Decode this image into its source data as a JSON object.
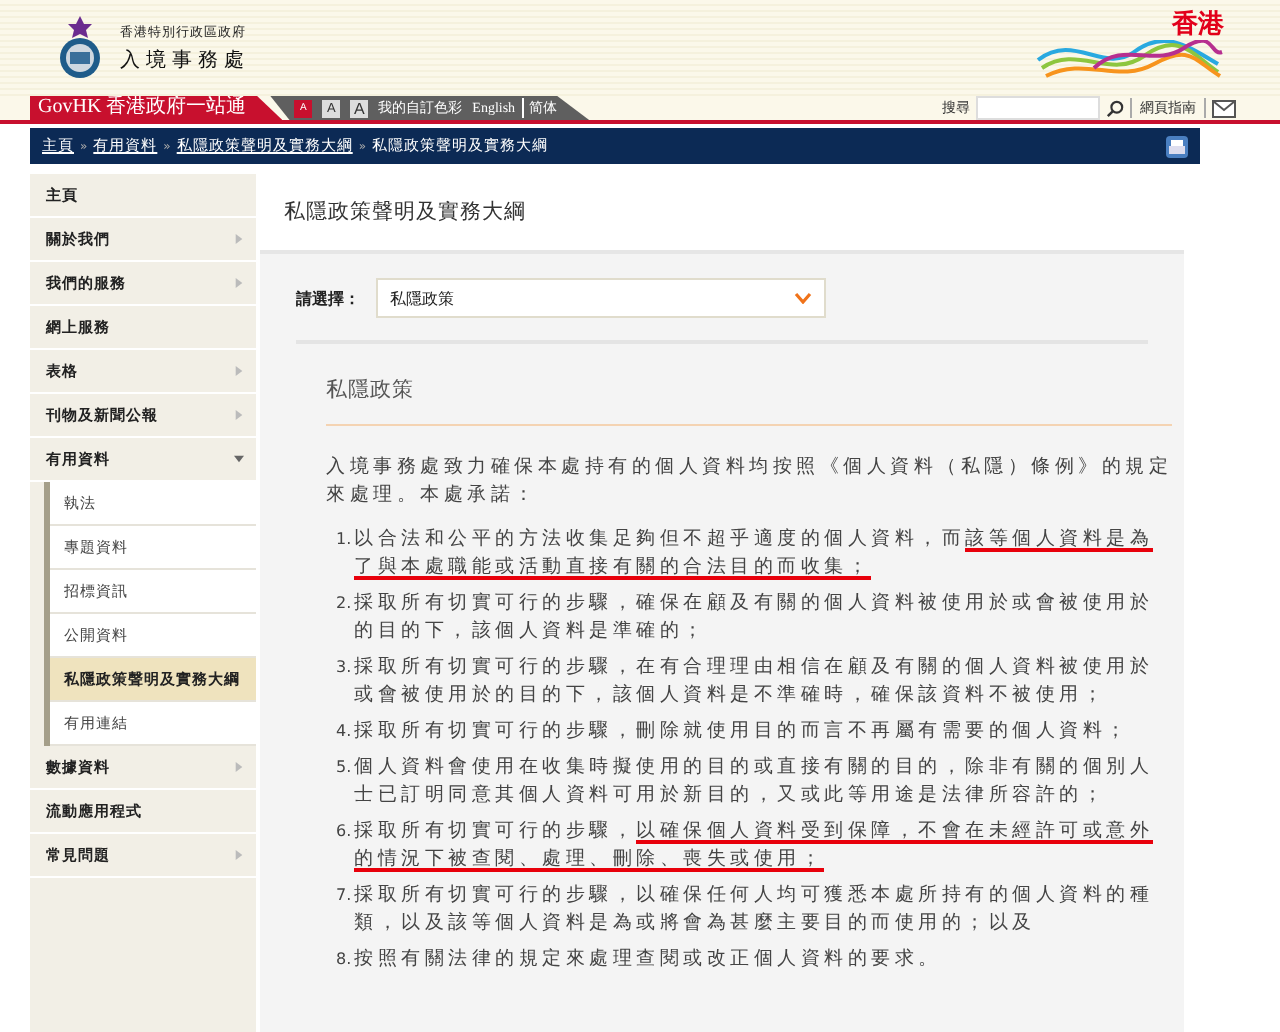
{
  "header": {
    "government": "香港特別行政區政府",
    "department": "入境事務處",
    "brand": "香港"
  },
  "topbar": {
    "govhk": "GovHK 香港政府一站通",
    "font_size_buttons": [
      "A",
      "A",
      "A"
    ],
    "custom_colour": "我的自訂色彩",
    "languages": [
      "English",
      "简体"
    ],
    "search_label": "搜尋",
    "site_guide": "網頁指南"
  },
  "breadcrumb_separator": "»",
  "breadcrumb": [
    {
      "label": "主頁",
      "link": true
    },
    {
      "label": "有用資料",
      "link": true
    },
    {
      "label": "私隱政策聲明及實務大綱",
      "link": true
    },
    {
      "label": "私隱政策聲明及實務大綱",
      "link": false
    }
  ],
  "sidebar": {
    "items": [
      {
        "label": "主頁",
        "has_submenu": false,
        "expanded": false,
        "selected": false
      },
      {
        "label": "關於我們",
        "has_submenu": true,
        "expanded": false,
        "selected": false
      },
      {
        "label": "我們的服務",
        "has_submenu": true,
        "expanded": false,
        "selected": false
      },
      {
        "label": "網上服務",
        "has_submenu": false,
        "expanded": false,
        "selected": false
      },
      {
        "label": "表格",
        "has_submenu": true,
        "expanded": false,
        "selected": false
      },
      {
        "label": "刊物及新聞公報",
        "has_submenu": true,
        "expanded": false,
        "selected": false
      },
      {
        "label": "有用資料",
        "has_submenu": true,
        "expanded": true,
        "selected": false,
        "children": [
          {
            "label": "執法",
            "selected": false
          },
          {
            "label": "專題資料",
            "selected": false
          },
          {
            "label": "招標資訊",
            "selected": false
          },
          {
            "label": "公開資料",
            "selected": false
          },
          {
            "label": "私隱政策聲明及實務大綱",
            "selected": true
          },
          {
            "label": "有用連結",
            "selected": false
          }
        ]
      },
      {
        "label": "數據資料",
        "has_submenu": true,
        "expanded": false,
        "selected": false
      },
      {
        "label": "流動應用程式",
        "has_submenu": false,
        "expanded": false,
        "selected": false
      },
      {
        "label": "常見問題",
        "has_submenu": true,
        "expanded": false,
        "selected": false
      }
    ]
  },
  "page_title": "私隱政策聲明及實務大綱",
  "selector": {
    "label": "請選擇：",
    "value": "私隱政策"
  },
  "section": {
    "heading": "私隱政策",
    "intro": "入境事務處致力確保本處持有的個人資料均按照《個人資料（私隱）條例》的規定來處理。本處承諾：",
    "items": [
      {
        "number": "1.",
        "parts": [
          {
            "text": "以合法和公平的方法收集足夠但不超乎適度的個人資料，而",
            "underlined": false
          },
          {
            "text": "該等個人資料是為了與本處職能或活動直接有關的合法目的而收集；",
            "underlined": true
          }
        ]
      },
      {
        "number": "2.",
        "parts": [
          {
            "text": "採取所有切實可行的步驟，確保在顧及有關的個人資料被使用於或會被使用於的目的下，該個人資料是準確的；",
            "underlined": false
          }
        ]
      },
      {
        "number": "3.",
        "parts": [
          {
            "text": "採取所有切實可行的步驟，在有合理理由相信在顧及有關的個人資料被使用於或會被使用於的目的下，該個人資料是不準確時，確保該資料不被使用；",
            "underlined": false
          }
        ]
      },
      {
        "number": "4.",
        "parts": [
          {
            "text": "採取所有切實可行的步驟，刪除就使用目的而言不再屬有需要的個人資料；",
            "underlined": false
          }
        ]
      },
      {
        "number": "5.",
        "parts": [
          {
            "text": "個人資料會使用在收集時擬使用的目的或直接有關的目的，除非有關的個別人士已訂明同意其個人資料可用於新目的，又或此等用途是法律所容許的；",
            "underlined": false
          }
        ]
      },
      {
        "number": "6.",
        "parts": [
          {
            "text": "採取所有切實可行的步驟，",
            "underlined": false
          },
          {
            "text": "以確保個人資料受到保障，不會在未經許可或意外的情況下被查閱、處理、刪除、喪失或使用；",
            "underlined": true
          }
        ]
      },
      {
        "number": "7.",
        "parts": [
          {
            "text": "採取所有切實可行的步驟，以確保任何人均可獲悉本處所持有的個人資料的種類，以及該等個人資料是為或將會為甚麼主要目的而使用的；以及",
            "underlined": false
          }
        ]
      },
      {
        "number": "8.",
        "parts": [
          {
            "text": "按照有關法律的規定來處理查閱或改正個人資料的要求。",
            "underlined": false
          }
        ]
      }
    ]
  }
}
